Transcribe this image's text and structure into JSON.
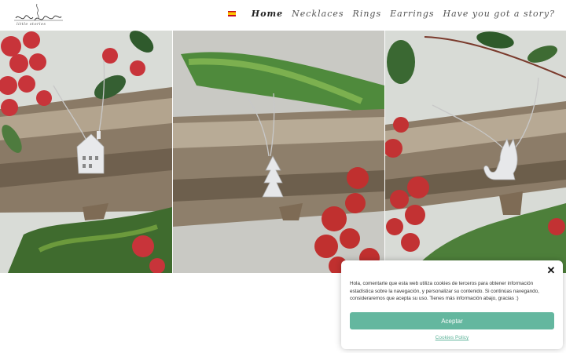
{
  "header": {
    "logo_text": "ani's",
    "logo_subtitle": "little stories",
    "language": "spanish-flag-icon",
    "nav": [
      {
        "label": "Home",
        "active": true
      },
      {
        "label": "Necklaces",
        "active": false
      },
      {
        "label": "Rings",
        "active": false
      },
      {
        "label": "Earrings",
        "active": false
      },
      {
        "label": "Have you got a story?",
        "active": false
      }
    ]
  },
  "gallery": {
    "images": [
      {
        "subject": "house-pendant-necklace"
      },
      {
        "subject": "tree-pendant-necklace"
      },
      {
        "subject": "cat-pendant-necklace"
      }
    ]
  },
  "cookie": {
    "text": "Hola, comentarte que esta web utiliza cookies de terceros para obtener información estadística sobre la navegación, y personalizar su contenido. Si continúas navegando, consideraremos que acepta su uso. Tienes más información abajo, gracias :)",
    "accept_label": "Aceptar",
    "policy_label": "Cookies Policy",
    "accent_color": "#64b79f"
  }
}
